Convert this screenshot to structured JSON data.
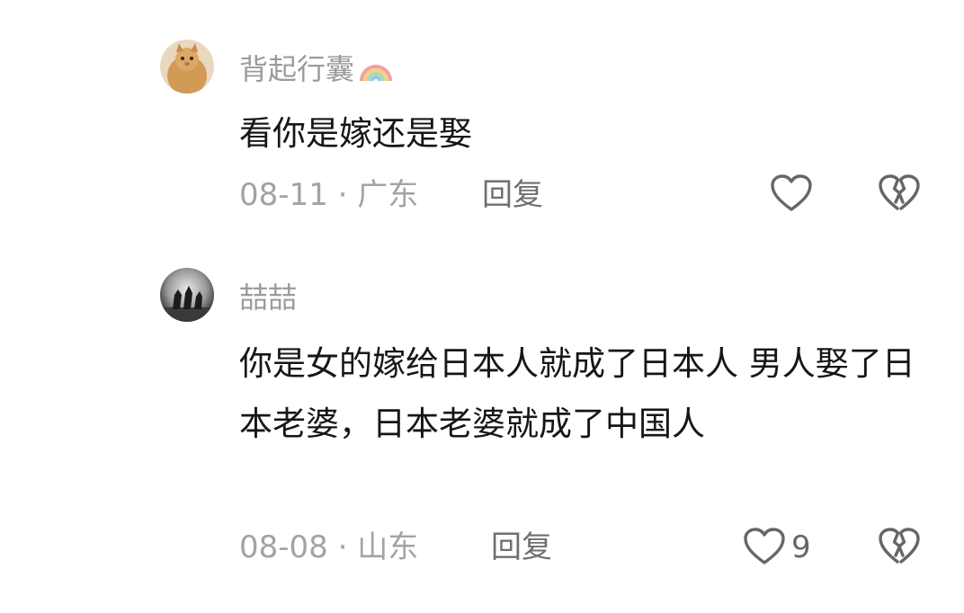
{
  "comments": [
    {
      "username": "背起行囊",
      "text": "看你是嫁还是娶",
      "date": "08-11",
      "separator": "·",
      "location": "广东",
      "reply_label": "回复",
      "like_count": ""
    },
    {
      "username": "喆喆",
      "text": "你是女的嫁给日本人就成了日本人 男人娶了日本老婆，日本老婆就成了中国人",
      "date": "08-08",
      "separator": "·",
      "location": "山东",
      "reply_label": "回复",
      "like_count": "9"
    }
  ],
  "icons": {
    "like": "heart-outline-icon",
    "dislike": "broken-heart-icon",
    "badge": "rainbow-icon"
  },
  "colors": {
    "username": "#9b9b9b",
    "body_text": "#161616",
    "meta": "#a3a3a3",
    "icon": "#666666"
  }
}
